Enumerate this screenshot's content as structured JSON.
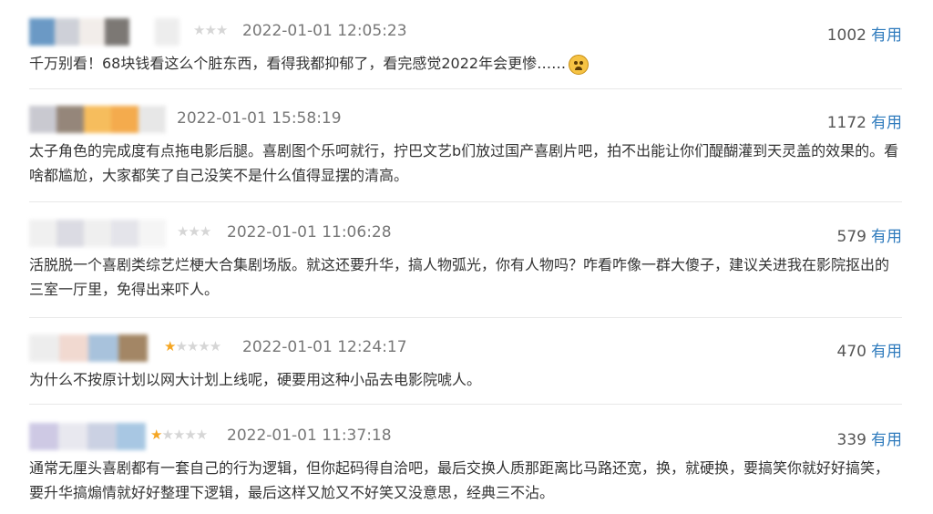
{
  "colors": {
    "star_on": "#f5a623",
    "star_off": "#d6d6d6",
    "link": "#2f7bbd",
    "timestamp": "#777777"
  },
  "comments": [
    {
      "rating": 0,
      "time": "2022-01-01 12:05:23",
      "votes": "1002",
      "useful_label": "有用",
      "text": "千万别看！68块钱看这么个脏东西，看得我都抑郁了，看完感觉2022年会更惨……",
      "emoji": "sad-face-icon"
    },
    {
      "rating": 0,
      "time": "2022-01-01 15:58:19",
      "votes": "1172",
      "useful_label": "有用",
      "text": "太子角色的完成度有点拖电影后腿。喜剧图个乐呵就行，拧巴文艺b们放过国产喜剧片吧，拍不出能让你们醍醐灌到天灵盖的效果的。看啥都尴尬，大家都笑了自己没笑不是什么值得显摆的清高。"
    },
    {
      "rating": 0,
      "time": "2022-01-01 11:06:28",
      "votes": "579",
      "useful_label": "有用",
      "text": "活脱脱一个喜剧类综艺烂梗大合集剧场版。就这还要升华，搞人物弧光，你有人物吗？咋看咋像一群大傻子，建议关进我在影院抠出的三室一厅里，免得出来吓人。"
    },
    {
      "rating": 1,
      "time": "2022-01-01 12:24:17",
      "votes": "470",
      "useful_label": "有用",
      "text": "为什么不按原计划以网大计划上线呢，硬要用这种小品去电影院唬人。"
    },
    {
      "rating": 1,
      "time": "2022-01-01 11:37:18",
      "votes": "339",
      "useful_label": "有用",
      "text": "通常无厘头喜剧都有一套自己的行为逻辑，但你起码得自洽吧，最后交换人质那距离比马路还宽，换，就硬换，要搞笑你就好好搞笑，要升华搞煽情就好好整理下逻辑，最后这样又尬又不好笑又没意思，经典三不沾。"
    }
  ]
}
